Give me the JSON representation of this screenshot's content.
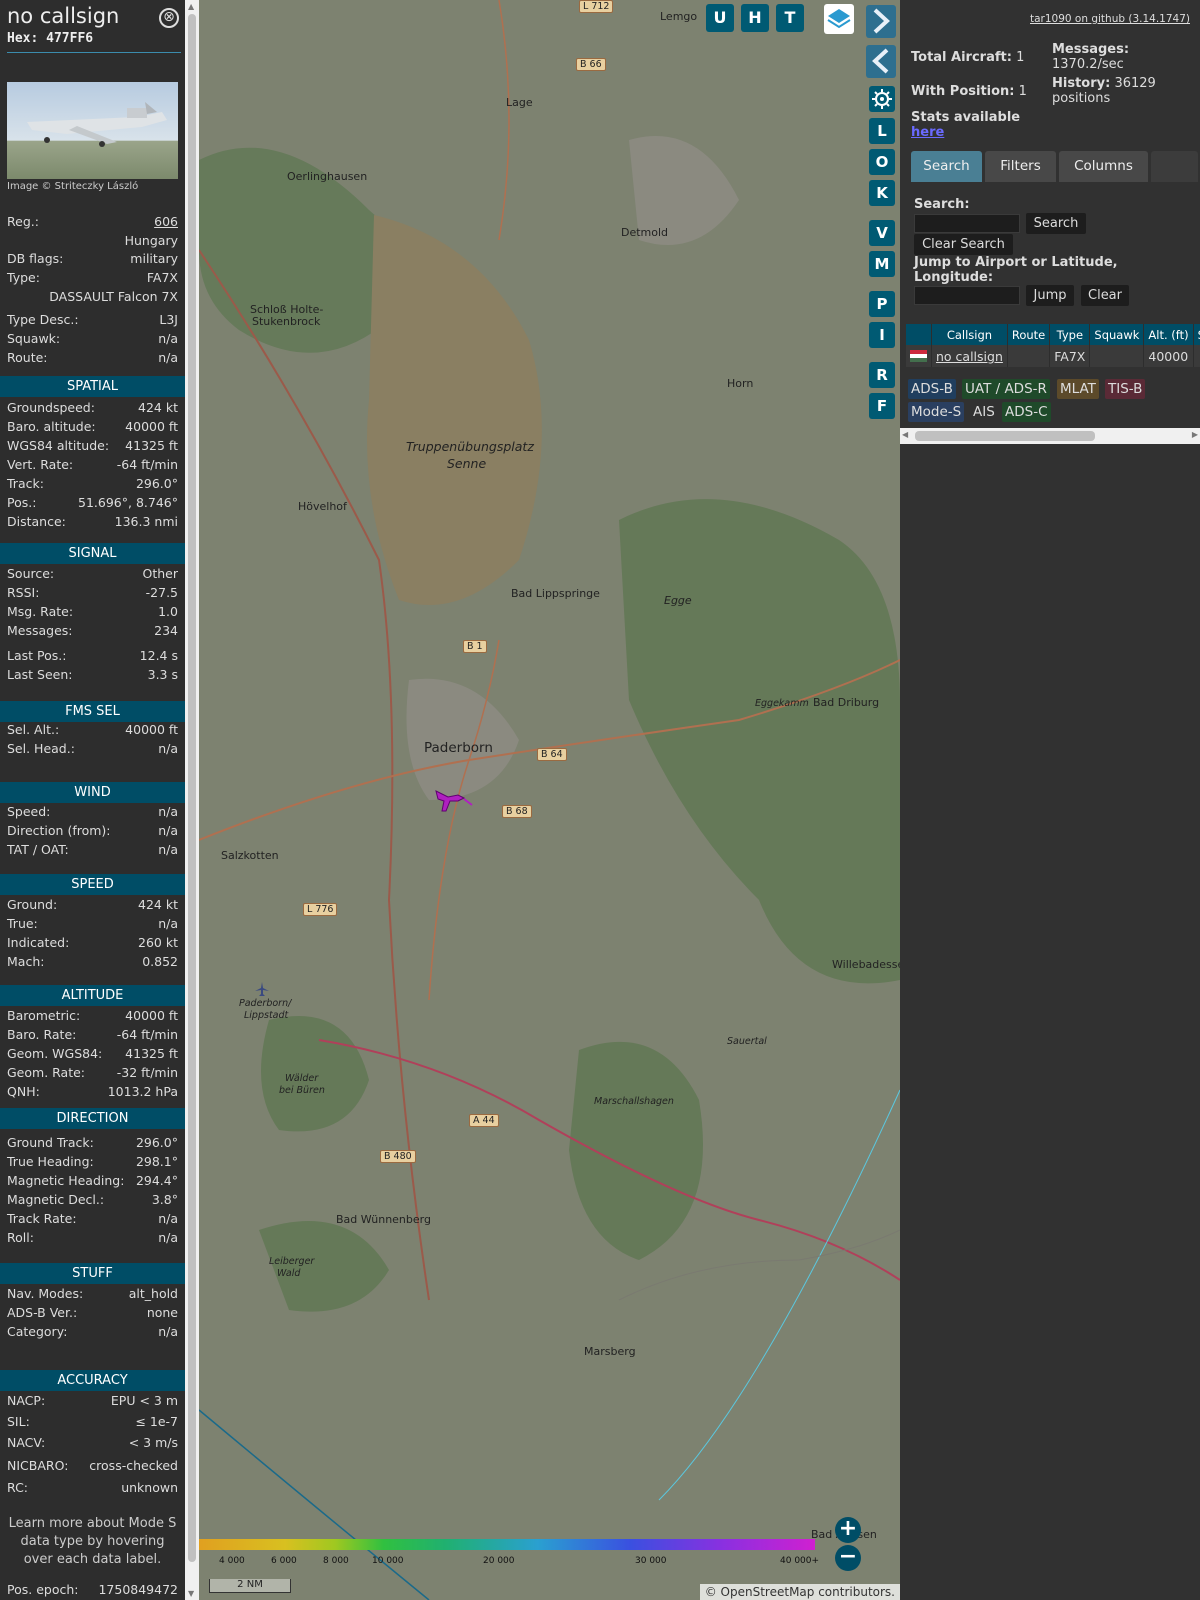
{
  "info": {
    "callsign": "no callsign",
    "hex": "Hex: 477FF6",
    "close": "⊗",
    "credit": "Image © Striteczky László",
    "top_rows": [
      {
        "k": "Reg.:",
        "v": "606"
      },
      {
        "k": "",
        "v": "Hungary"
      },
      {
        "k": "DB flags:",
        "v": "military"
      },
      {
        "k": "Type:",
        "v": "FA7X"
      },
      {
        "k": "",
        "v": "DASSAULT Falcon 7X"
      },
      {
        "k": "Type Desc.:",
        "v": "L3J"
      },
      {
        "k": "Squawk:",
        "v": "n/a"
      },
      {
        "k": "Route:",
        "v": "n/a"
      }
    ],
    "sections": [
      {
        "title": "SPATIAL",
        "rows": [
          {
            "k": "Groundspeed:",
            "v": "424 kt"
          },
          {
            "k": "Baro. altitude:",
            "v": "40000 ft"
          },
          {
            "k": "WGS84 altitude:",
            "v": "41325 ft"
          },
          {
            "k": "Vert. Rate:",
            "v": "-64 ft/min"
          },
          {
            "k": "Track:",
            "v": "296.0°"
          },
          {
            "k": "Pos.:",
            "v": "51.696°, 8.746°"
          },
          {
            "k": "Distance:",
            "v": "136.3 nmi"
          }
        ]
      },
      {
        "title": "SIGNAL",
        "rows": [
          {
            "k": "Source:",
            "v": "Other"
          },
          {
            "k": "RSSI:",
            "v": "-27.5"
          },
          {
            "k": "Msg. Rate:",
            "v": "1.0"
          },
          {
            "k": "Messages:",
            "v": "234"
          },
          {
            "k": "Last Pos.:",
            "v": "12.4 s"
          },
          {
            "k": "Last Seen:",
            "v": "3.3 s"
          }
        ]
      },
      {
        "title": "FMS SEL",
        "rows": [
          {
            "k": "Sel. Alt.:",
            "v": "40000 ft"
          },
          {
            "k": "Sel. Head.:",
            "v": "n/a"
          }
        ]
      },
      {
        "title": "WIND",
        "rows": [
          {
            "k": "Speed:",
            "v": "n/a"
          },
          {
            "k": "Direction (from):",
            "v": "n/a"
          },
          {
            "k": "TAT / OAT:",
            "v": "n/a"
          }
        ]
      },
      {
        "title": "SPEED",
        "rows": [
          {
            "k": "Ground:",
            "v": "424 kt"
          },
          {
            "k": "True:",
            "v": "n/a"
          },
          {
            "k": "Indicated:",
            "v": "260 kt"
          },
          {
            "k": "Mach:",
            "v": "0.852"
          }
        ]
      },
      {
        "title": "ALTITUDE",
        "rows": [
          {
            "k": "Barometric:",
            "v": "40000 ft"
          },
          {
            "k": "Baro. Rate:",
            "v": "-64 ft/min"
          },
          {
            "k": "Geom. WGS84:",
            "v": "41325 ft"
          },
          {
            "k": "Geom. Rate:",
            "v": "-32 ft/min"
          },
          {
            "k": "QNH:",
            "v": "1013.2 hPa"
          }
        ]
      },
      {
        "title": "DIRECTION",
        "rows": [
          {
            "k": "Ground Track:",
            "v": "296.0°"
          },
          {
            "k": "True Heading:",
            "v": "298.1°"
          },
          {
            "k": "Magnetic Heading:",
            "v": "294.4°"
          },
          {
            "k": "Magnetic Decl.:",
            "v": "3.8°"
          },
          {
            "k": "Track Rate:",
            "v": "n/a"
          },
          {
            "k": "Roll:",
            "v": "n/a"
          }
        ]
      },
      {
        "title": "STUFF",
        "rows": [
          {
            "k": "Nav. Modes:",
            "v": "alt_hold"
          },
          {
            "k": "ADS-B Ver.:",
            "v": "none"
          },
          {
            "k": "Category:",
            "v": "n/a"
          }
        ]
      },
      {
        "title": "ACCURACY",
        "rows": [
          {
            "k": "NACP:",
            "v": "EPU < 3 m"
          },
          {
            "k": "SIL:",
            "v": "≤ 1e-7"
          },
          {
            "k": "NACV:",
            "v": "< 3 m/s"
          },
          {
            "k": "NICBARO:",
            "v": "cross-checked"
          },
          {
            "k": "RC:",
            "v": "unknown"
          }
        ]
      }
    ],
    "note": "Learn more about Mode S data type by hovering over each data label.",
    "pos_epoch": {
      "k": "Pos. epoch:",
      "v": "1750849472"
    }
  },
  "map": {
    "top_buttons": [
      "U",
      "H",
      "T"
    ],
    "side_buttons": [
      "L",
      "O",
      "K",
      "V",
      "M",
      "P",
      "I",
      "R",
      "F"
    ],
    "places": [
      {
        "n": "Lemgo"
      },
      {
        "n": "Lage"
      },
      {
        "n": "Oerlinghausen"
      },
      {
        "n": "Detmold"
      },
      {
        "n": "Schloß Holte-"
      },
      {
        "n": "Stukenbrock"
      },
      {
        "n": "Truppenübungsplatz"
      },
      {
        "n": "Senne"
      },
      {
        "n": "Hövelhof"
      },
      {
        "n": "Horn"
      },
      {
        "n": "Bad Lippspringe"
      },
      {
        "n": "Egge"
      },
      {
        "n": "Paderborn"
      },
      {
        "n": "Bad Driburg"
      },
      {
        "n": "Salzkotten"
      },
      {
        "n": "Willebadessen"
      },
      {
        "n": "Paderborn/"
      },
      {
        "n": "Lippstadt"
      },
      {
        "n": "Sauertal"
      },
      {
        "n": "Marschallshagen"
      },
      {
        "n": "Bad Wünnenberg"
      },
      {
        "n": "Marsberg"
      },
      {
        "n": "Eggekamm"
      },
      {
        "n": "Leiberger"
      },
      {
        "n": "Wald"
      },
      {
        "n": "Wälder"
      },
      {
        "n": "bei Büren"
      },
      {
        "n": "Bad Arolsen"
      }
    ],
    "roads": [
      "L 712",
      "B 66",
      "B 1",
      "B 64",
      "B 68",
      "L 776",
      "A 44",
      "B 480"
    ],
    "scale_ticks": [
      "4 000",
      "6 000",
      "8 000",
      "10 000",
      "20 000",
      "30 000",
      "40 000+"
    ],
    "nm_scale": "2 NM",
    "attribution": "© OpenStreetMap contributors.",
    "zoom_in": "+",
    "zoom_out": "−"
  },
  "panel": {
    "github": "tar1090 on github (3.14.1747)",
    "total_aircraft_label": "Total Aircraft:",
    "total_aircraft": "1",
    "with_position_label": "With Position:",
    "with_position": "1",
    "messages_label": "Messages:",
    "messages": "1370.2/sec",
    "history_label": "History:",
    "history": "36129 positions",
    "stats_label": "Stats available",
    "stats_link": "here",
    "tabs": [
      "Search",
      "Filters",
      "Columns"
    ],
    "search_label": "Search:",
    "search_btn": "Search",
    "clear_search_btn": "Clear Search",
    "jump_label": "Jump to Airport or Latitude, Longitude:",
    "jump_btn": "Jump",
    "clear_btn": "Clear",
    "table": {
      "headers": [
        "",
        "Callsign",
        "Route",
        "Type",
        "Squawk",
        "Alt. (ft)",
        "S"
      ],
      "rows": [
        [
          "",
          "no callsign",
          "",
          "FA7X",
          "",
          "40000",
          ""
        ]
      ]
    },
    "tags": [
      {
        "t": "ADS-B",
        "bg": "#203e5e",
        "c": "#ddd"
      },
      {
        "t": "UAT / ADS-R",
        "bg": "#1f4a2a",
        "c": "#ddd"
      },
      {
        "t": "MLAT",
        "bg": "#5c4a2a",
        "c": "#ddd"
      },
      {
        "t": "TIS-B",
        "bg": "#5a2a36",
        "c": "#ddd"
      },
      {
        "t": "Mode-S",
        "bg": "#2a3f60",
        "c": "#ddd"
      },
      {
        "t": "AIS",
        "bg": "transparent",
        "c": "#ddd"
      },
      {
        "t": "ADS-C",
        "bg": "#1f4a2a",
        "c": "#ddd"
      }
    ]
  }
}
